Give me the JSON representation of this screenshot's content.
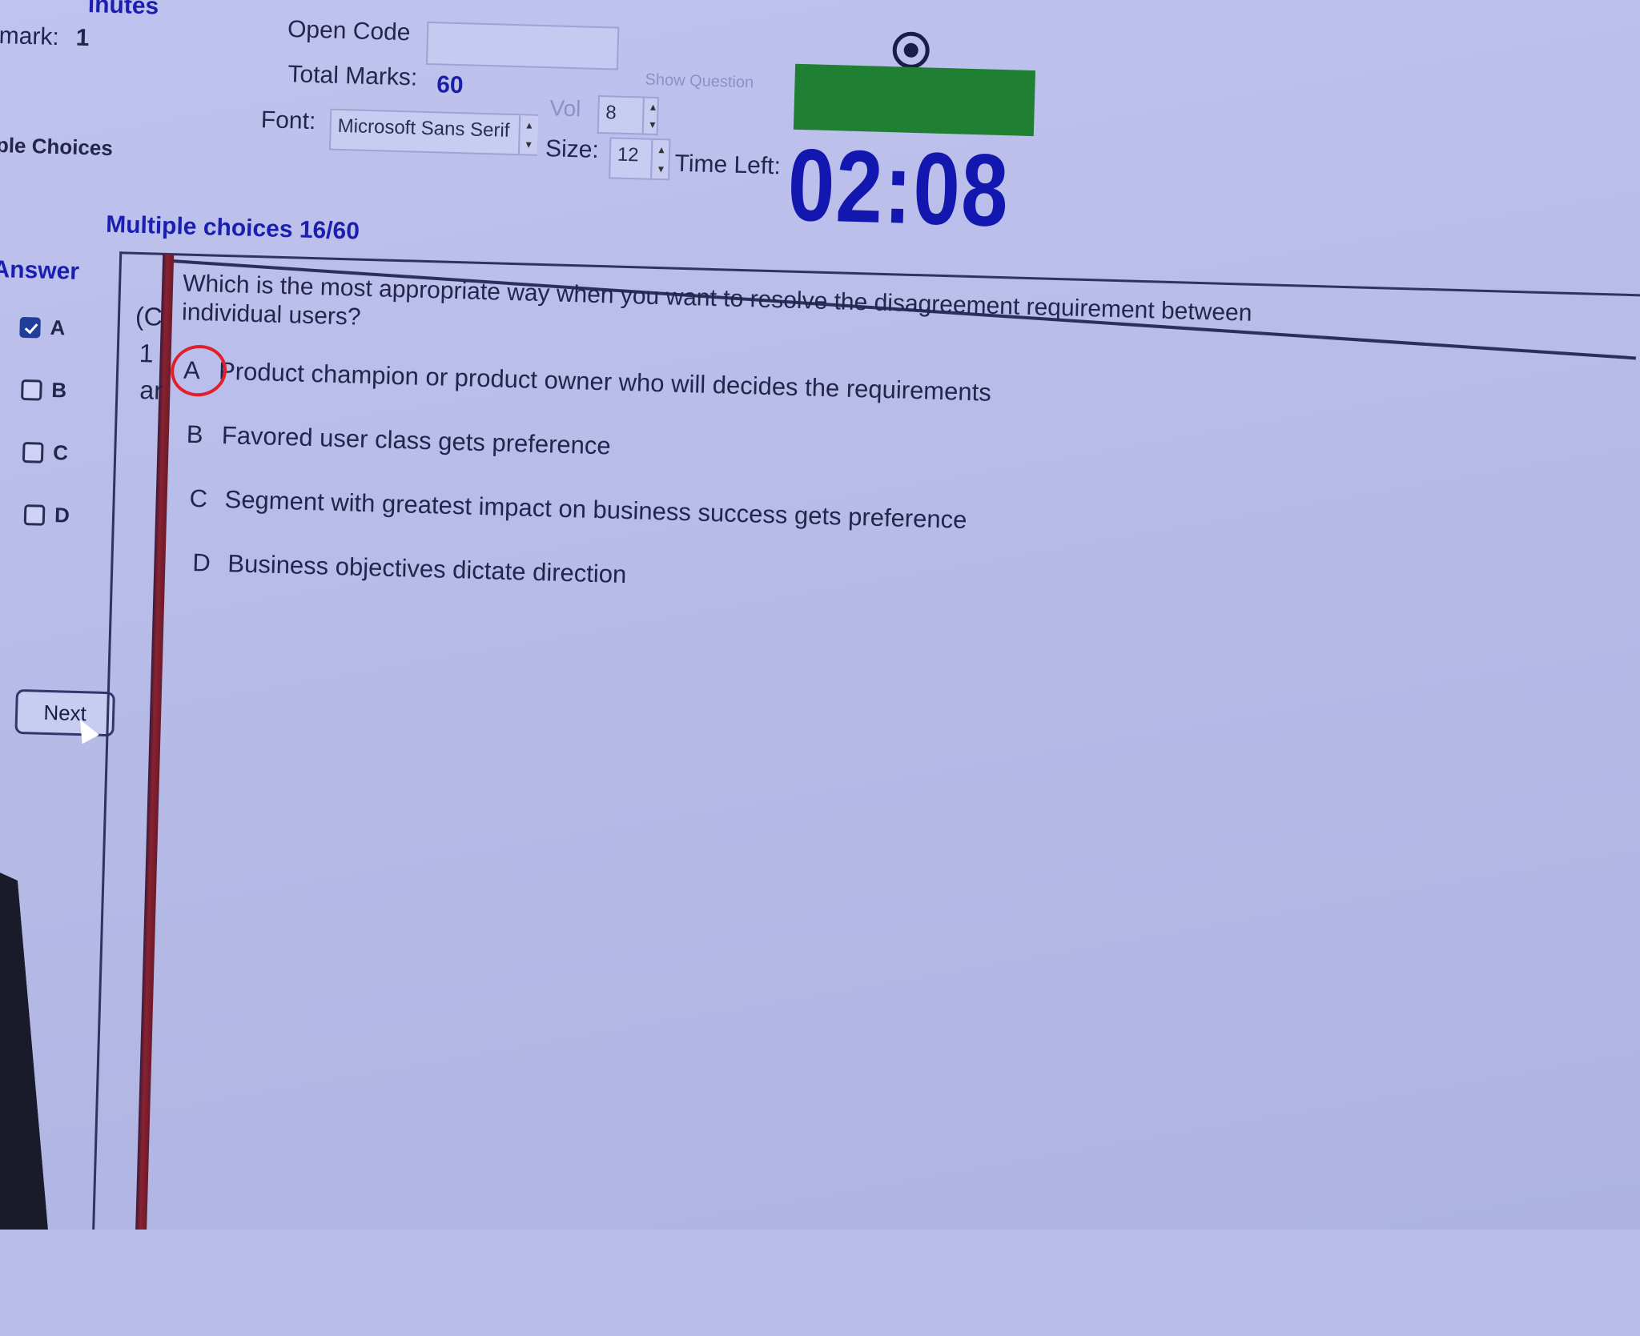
{
  "header": {
    "top_fragment": "inutes",
    "mark_label": "mark:",
    "mark_value": "1",
    "section_fragment": "ple Choices",
    "open_code_label": "Open Code",
    "open_code_value": "",
    "show_question_label": "Show Question",
    "total_marks_label": "Total Marks:",
    "total_marks_value": "60",
    "vol_label": "Vol",
    "vol_value": "8",
    "font_label": "Font:",
    "font_value": "Microsoft Sans Serif",
    "size_label": "Size:",
    "size_value": "12",
    "time_left_label": "Time Left:",
    "time_left_value": "02:08"
  },
  "section": {
    "title": "Multiple choices 16/60"
  },
  "answer_panel": {
    "heading": "Answer",
    "options": [
      {
        "letter": "A",
        "checked": true
      },
      {
        "letter": "B",
        "checked": false
      },
      {
        "letter": "C",
        "checked": false
      },
      {
        "letter": "D",
        "checked": false
      }
    ],
    "next_label": "Next"
  },
  "side_fragments": {
    "line1": "(C",
    "line2": "1",
    "line3": "ar"
  },
  "question": {
    "text": "Which is the most appropriate way when you want to resolve the disagreement requirement between individual users?",
    "choices": [
      {
        "letter": "A",
        "text": "Product champion or product owner who will decides the requirements"
      },
      {
        "letter": "B",
        "text": "Favored user class gets preference"
      },
      {
        "letter": "C",
        "text": "Segment with greatest impact on business success gets preference"
      },
      {
        "letter": "D",
        "text": "Business objectives dictate direction"
      }
    ]
  },
  "colors": {
    "timer": "#1317b0",
    "section_title": "#1a1fb0",
    "progress_green": "#1f7f33",
    "annotation_red": "#e0202c"
  }
}
